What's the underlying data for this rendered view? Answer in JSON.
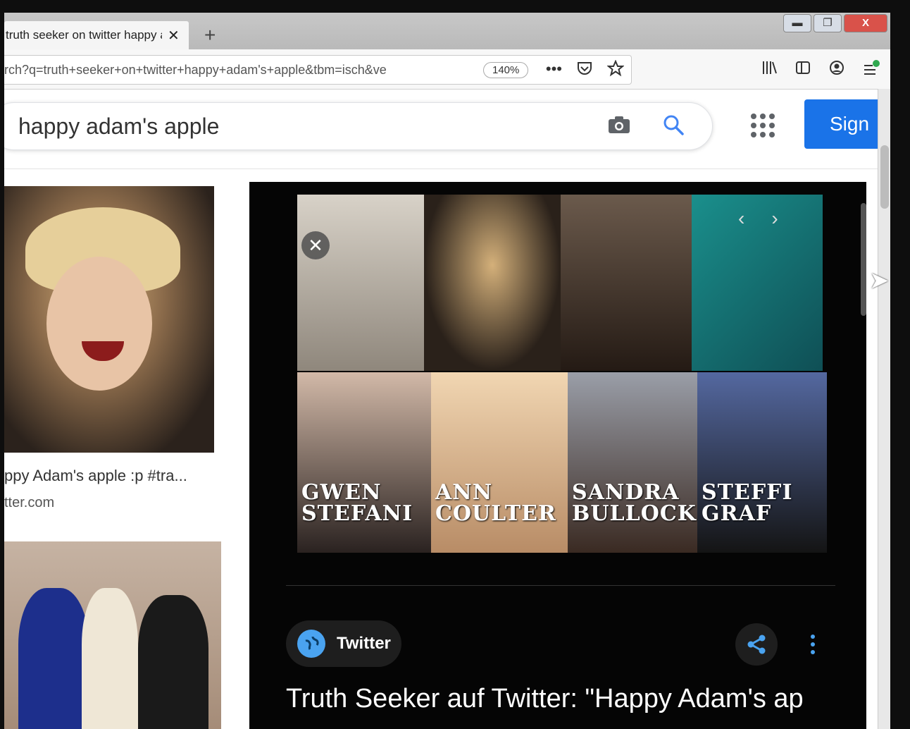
{
  "tab": {
    "title": "truth seeker on twitter happy a",
    "close_label": "✕",
    "new_tab_label": "+"
  },
  "window_controls": {
    "minimize": "▬",
    "maximize": "❐",
    "close": "X"
  },
  "navbar": {
    "url": "rch?q=truth+seeker+on+twitter+happy+adam's+apple&tbm=isch&ve",
    "zoom": "140%",
    "page_actions_label": "•••"
  },
  "google": {
    "query": "happy adam's apple",
    "sign_in_label": "Sign"
  },
  "results": {
    "left_caption": "ppy Adam's apple :p #tra...",
    "left_source": "tter.com"
  },
  "preview": {
    "collage_names": [
      {
        "line1": "GWEN",
        "line2": "STEFANI"
      },
      {
        "line1": "ANN",
        "line2": "COULTER"
      },
      {
        "line1": "SANDRA",
        "line2": "BULLOCK"
      },
      {
        "line1": "STEFFI",
        "line2": "GRAF"
      }
    ],
    "source_name": "Twitter",
    "title": "Truth Seeker auf Twitter: \"Happy Adam's ap"
  },
  "icons": {
    "camera": "camera-icon",
    "search": "search-icon",
    "apps": "apps-grid-icon",
    "share": "share-icon",
    "more": "more-vert-icon",
    "globe": "globe-icon"
  },
  "colors": {
    "accent": "#1a73e8",
    "panel": "#050505",
    "globe": "#4aa3f0"
  }
}
